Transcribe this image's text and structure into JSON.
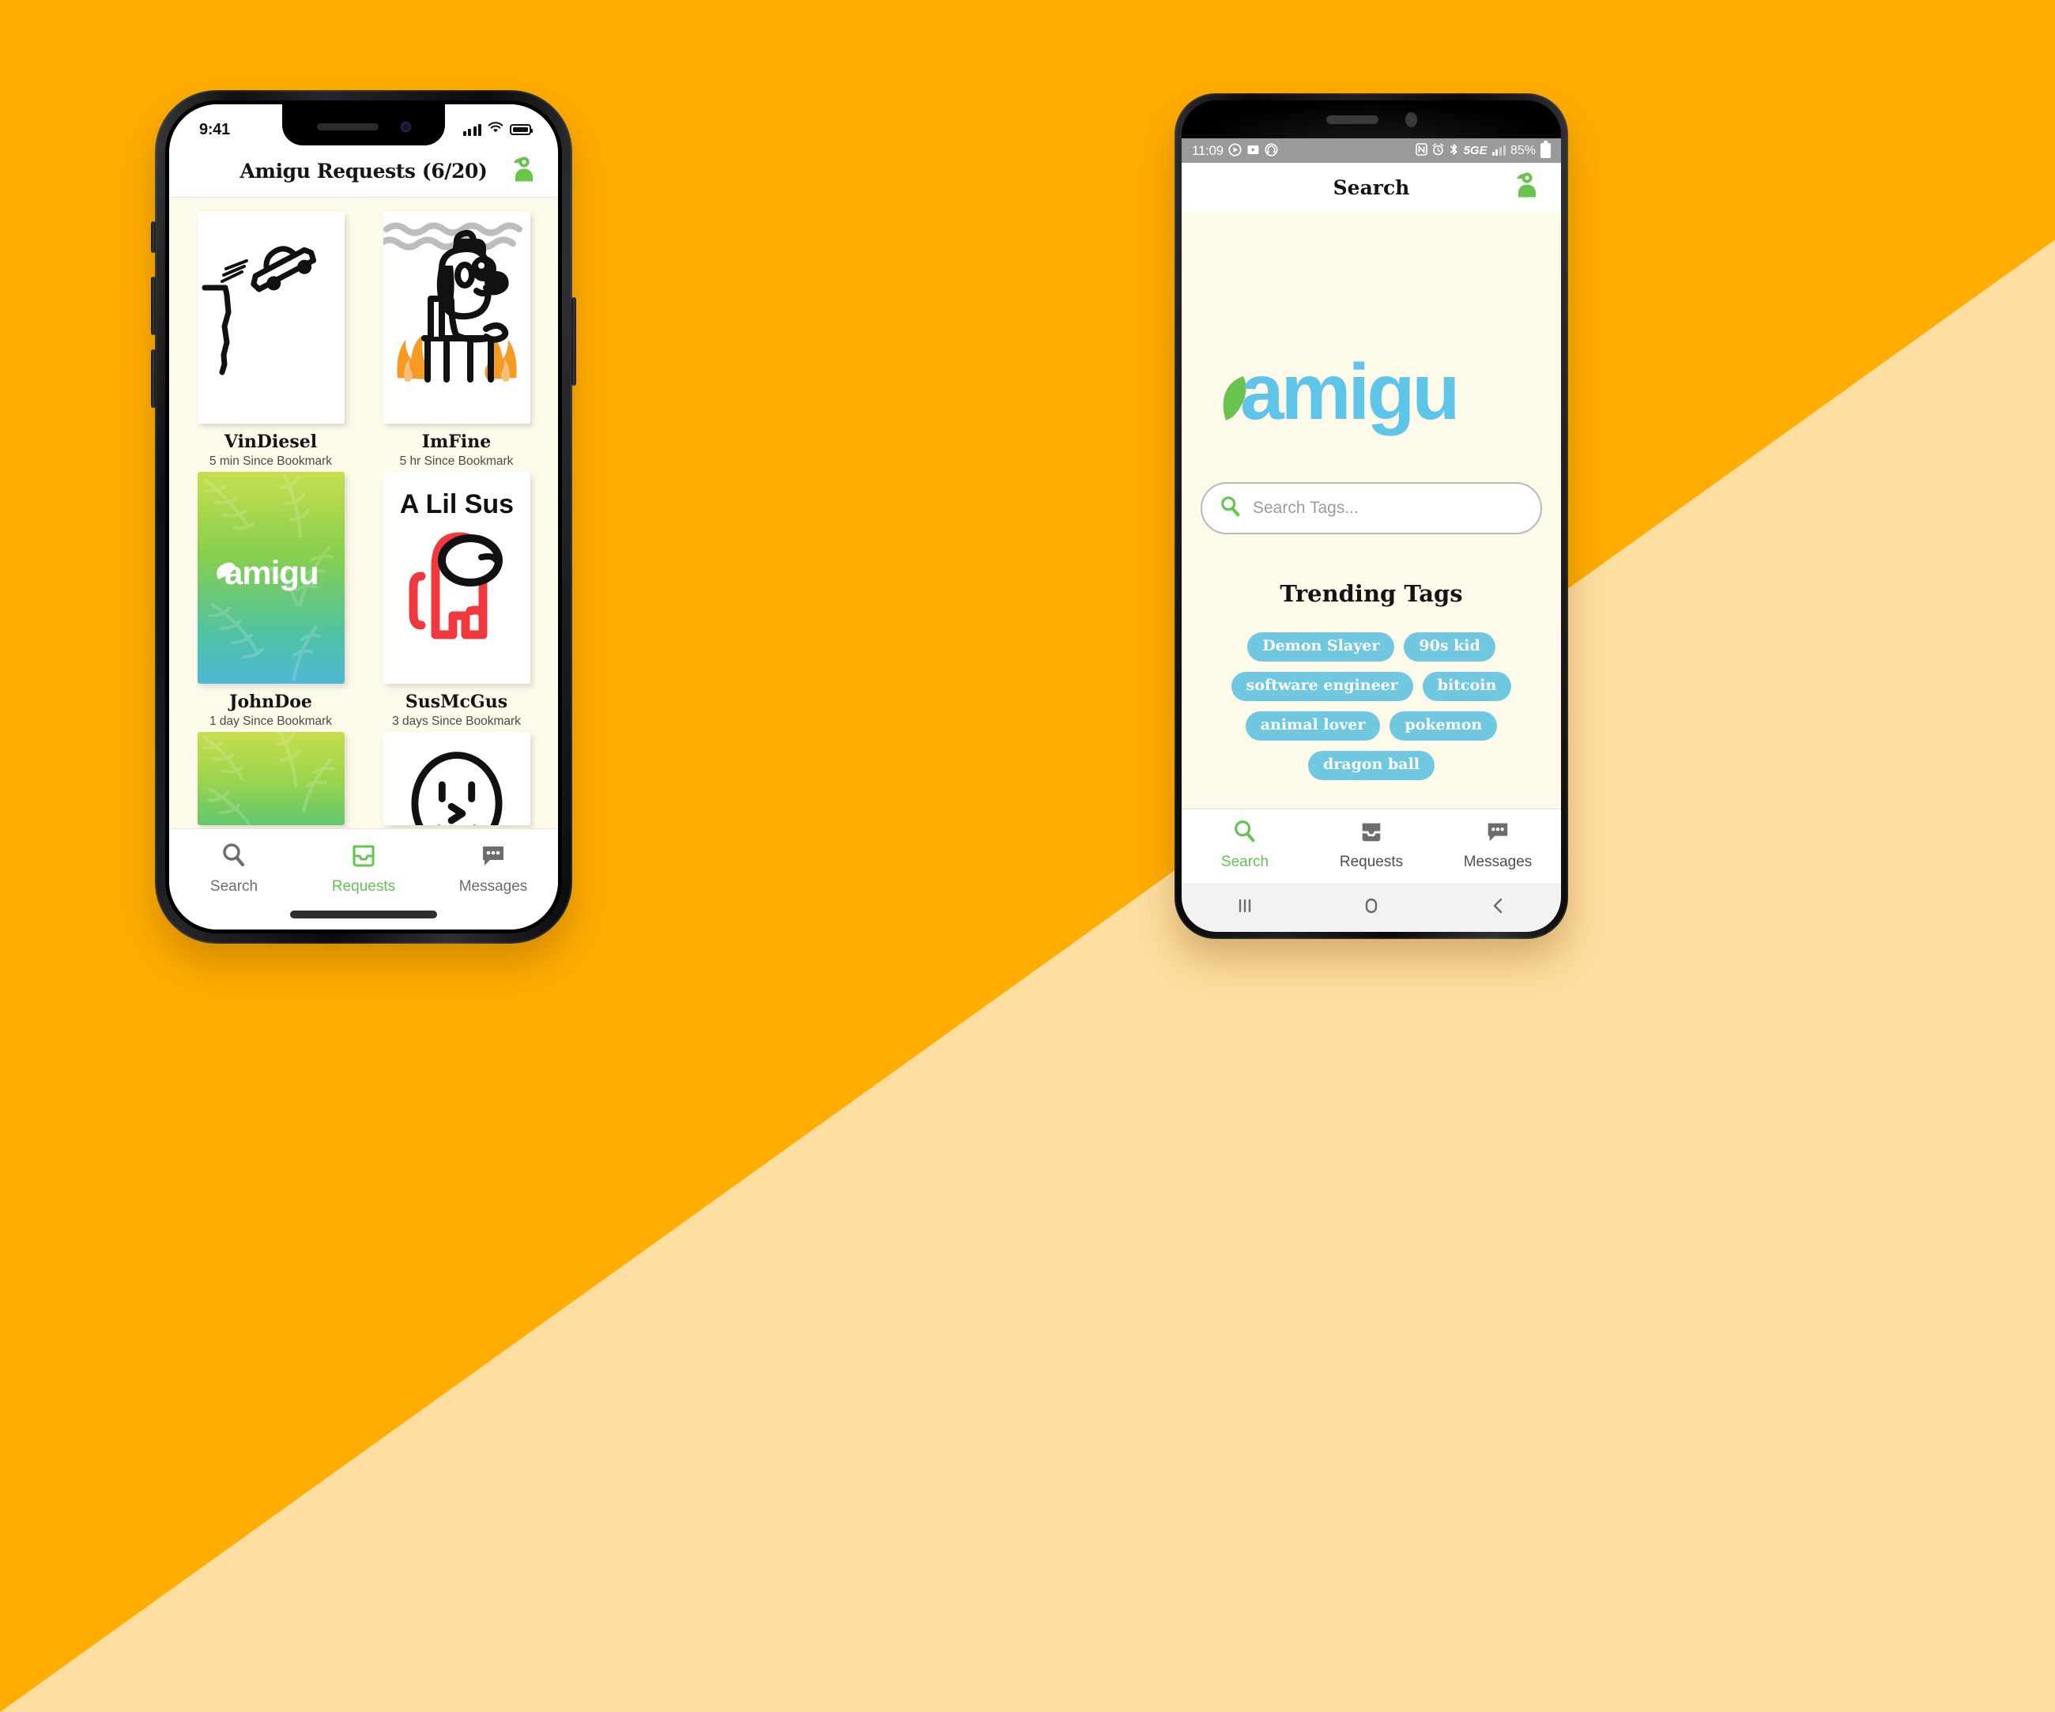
{
  "background": {
    "primary_color": "#FFAD00",
    "secondary_color": "#FEDEA0"
  },
  "theme": {
    "app_bg": "#FDFAEA",
    "accent_green": "#63C451",
    "logo_blue": "#5FC5E8",
    "logo_green": "#69C44F",
    "tag_blue": "#6FC8E0"
  },
  "iphone": {
    "status_bar": {
      "time": "9:41",
      "signal_icon": "cellular-bars-icon",
      "wifi_icon": "wifi-icon",
      "battery_icon": "battery-full-icon"
    },
    "header": {
      "title": "Amigu Requests (6/20)",
      "profile_icon": "profile-avatar-icon"
    },
    "cards": [
      {
        "name": "VinDiesel",
        "subtitle": "5 min Since Bookmark",
        "art": "car-off-cliff-doodle"
      },
      {
        "name": "ImFine",
        "subtitle": "5 hr Since Bookmark",
        "art": "dog-in-fire-doodle"
      },
      {
        "name": "JohnDoe",
        "subtitle": "1 day Since Bookmark",
        "art": "amigu-leaf-placeholder"
      },
      {
        "name": "SusMcGus",
        "subtitle": "3 days Since Bookmark",
        "art": "among-us-doodle",
        "caption": "A Lil Sus"
      },
      {
        "name": "",
        "subtitle": "",
        "art": "amigu-leaf-placeholder"
      },
      {
        "name": "",
        "subtitle": "",
        "art": "smiley-face-doodle"
      }
    ],
    "tabs": [
      {
        "label": "Search",
        "icon": "search-icon",
        "active": false
      },
      {
        "label": "Requests",
        "icon": "inbox-tray-icon",
        "active": true
      },
      {
        "label": "Messages",
        "icon": "chat-bubble-icon",
        "active": false
      }
    ]
  },
  "android": {
    "status_bar": {
      "time": "11:09",
      "left_icons": [
        "media-record-icon",
        "video-player-icon",
        "headphones-icon"
      ],
      "right_icons": [
        "nfc-icon",
        "alarm-icon",
        "bluetooth-icon"
      ],
      "network": "5GE",
      "battery_percent": "85%",
      "battery_icon": "battery-charging-icon"
    },
    "header": {
      "title": "Search",
      "profile_icon": "profile-avatar-icon"
    },
    "logo": {
      "text": "amigu",
      "mark": "leaf-swoosh-icon"
    },
    "search": {
      "placeholder": "Search Tags...",
      "value": "",
      "icon": "search-icon"
    },
    "trending": {
      "title": "Trending Tags",
      "tags": [
        "Demon Slayer",
        "90s kid",
        "software engineer",
        "bitcoin",
        "animal lover",
        "pokemon",
        "dragon ball"
      ]
    },
    "tabs": [
      {
        "label": "Search",
        "icon": "search-icon",
        "active": true
      },
      {
        "label": "Requests",
        "icon": "inbox-tray-icon",
        "active": false
      },
      {
        "label": "Messages",
        "icon": "chat-bubble-icon",
        "active": false
      }
    ],
    "nav_buttons": [
      {
        "icon": "recents-icon",
        "glyph": "|||"
      },
      {
        "icon": "home-circle-icon",
        "glyph": "○"
      },
      {
        "icon": "back-chevron-icon",
        "glyph": "‹"
      }
    ]
  }
}
